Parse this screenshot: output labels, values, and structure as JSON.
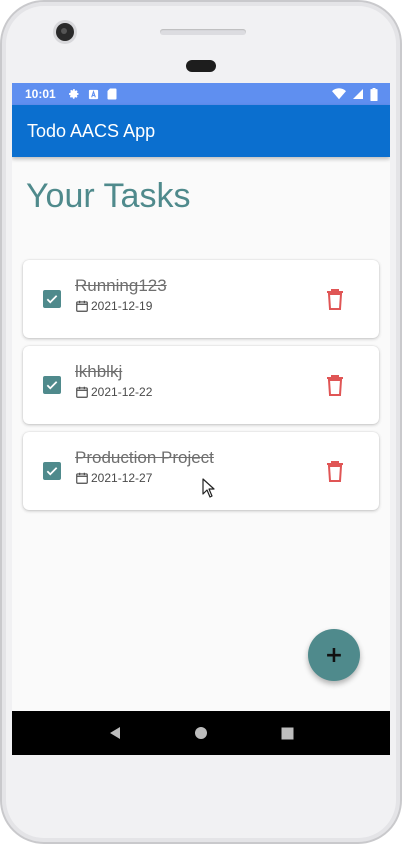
{
  "status_bar": {
    "time": "10:01",
    "left_icons": [
      "gear-icon",
      "a-icon",
      "sd-card-icon"
    ],
    "right_icons": [
      "wifi-icon",
      "signal-icon",
      "battery-icon"
    ],
    "color": "#5f8ff0"
  },
  "app_bar": {
    "title": "Todo AACS App",
    "color": "#0b6fcf"
  },
  "page": {
    "heading": "Your Tasks"
  },
  "tasks": [
    {
      "title": "Running123",
      "date": "2021-12-19",
      "completed": true
    },
    {
      "title": "lkhblkj",
      "date": "2021-12-22",
      "completed": true
    },
    {
      "title": "Production Project",
      "date": "2021-12-27",
      "completed": true
    }
  ],
  "fab": {
    "label": "+",
    "color": "#4f8a8c"
  },
  "colors": {
    "accent": "#4f8a8c",
    "delete": "#e05555"
  },
  "nav_bar": {
    "buttons": [
      "back-icon",
      "home-icon",
      "recents-icon"
    ]
  }
}
